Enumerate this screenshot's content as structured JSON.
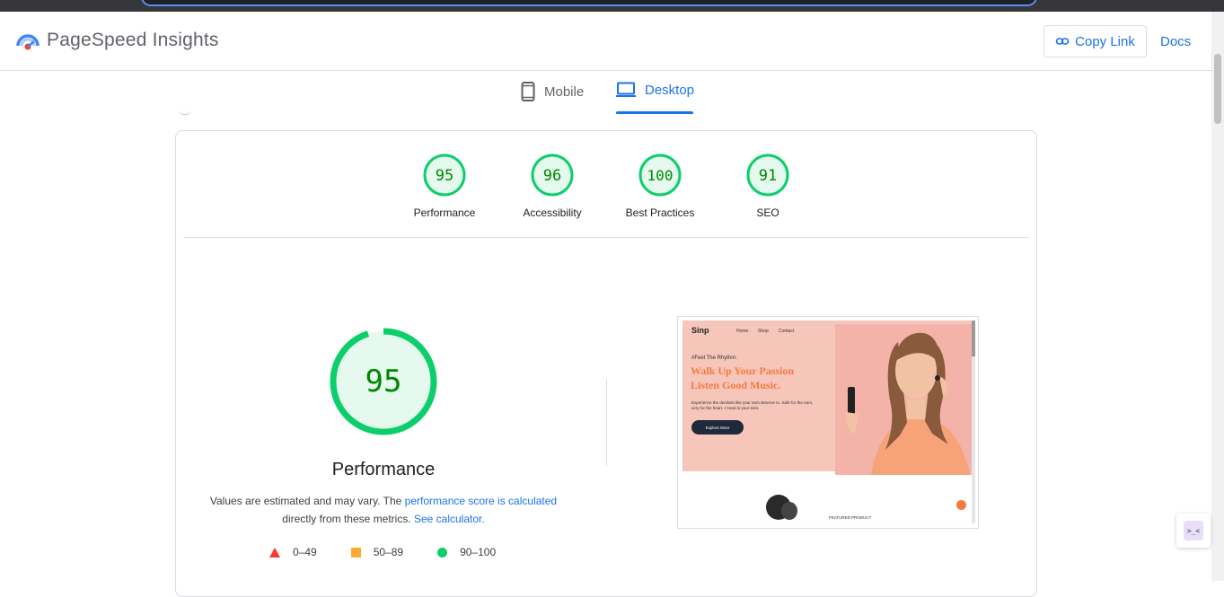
{
  "app": {
    "title": "PageSpeed Insights",
    "copy_link_label": "Copy Link",
    "docs_label": "Docs"
  },
  "tabs": [
    {
      "label": "Mobile",
      "icon": "phone-icon",
      "active": false
    },
    {
      "label": "Desktop",
      "icon": "laptop-icon",
      "active": true
    }
  ],
  "categories": [
    {
      "label": "Performance",
      "score": 95
    },
    {
      "label": "Accessibility",
      "score": 96
    },
    {
      "label": "Best Practices",
      "score": 100
    },
    {
      "label": "SEO",
      "score": 91
    }
  ],
  "performance": {
    "score": 95,
    "title": "Performance",
    "desc_prefix": "Values are estimated and may vary. The ",
    "desc_link1": "performance score is calculated",
    "desc_middle": " directly from these metrics. ",
    "desc_link2": "See calculator."
  },
  "legend": [
    {
      "range": "0–49",
      "shape": "triangle",
      "color": "#ff3333"
    },
    {
      "range": "50–89",
      "shape": "square",
      "color": "#ffaa33"
    },
    {
      "range": "90–100",
      "shape": "circle",
      "color": "#0cce6b"
    }
  ],
  "screenshot": {
    "brand": "Sinp",
    "nav": [
      "Home",
      "Shop",
      "Contact"
    ],
    "kicker": "#Feel The Rhythm.",
    "headline_1": "Walk Up Your Passion",
    "headline_2": "Listen Good Music.",
    "body": "Experience the decibels like your ears deserve to. Safe for the ears, very for the heart. A treat to your ears.",
    "cta": "Explore More",
    "featured": "FEATURED PRODUCT"
  },
  "colors": {
    "accent": "#1a73e8",
    "pass": "#0cce6b",
    "pass_fill": "#e6f9ee",
    "pass_text": "#008800"
  }
}
